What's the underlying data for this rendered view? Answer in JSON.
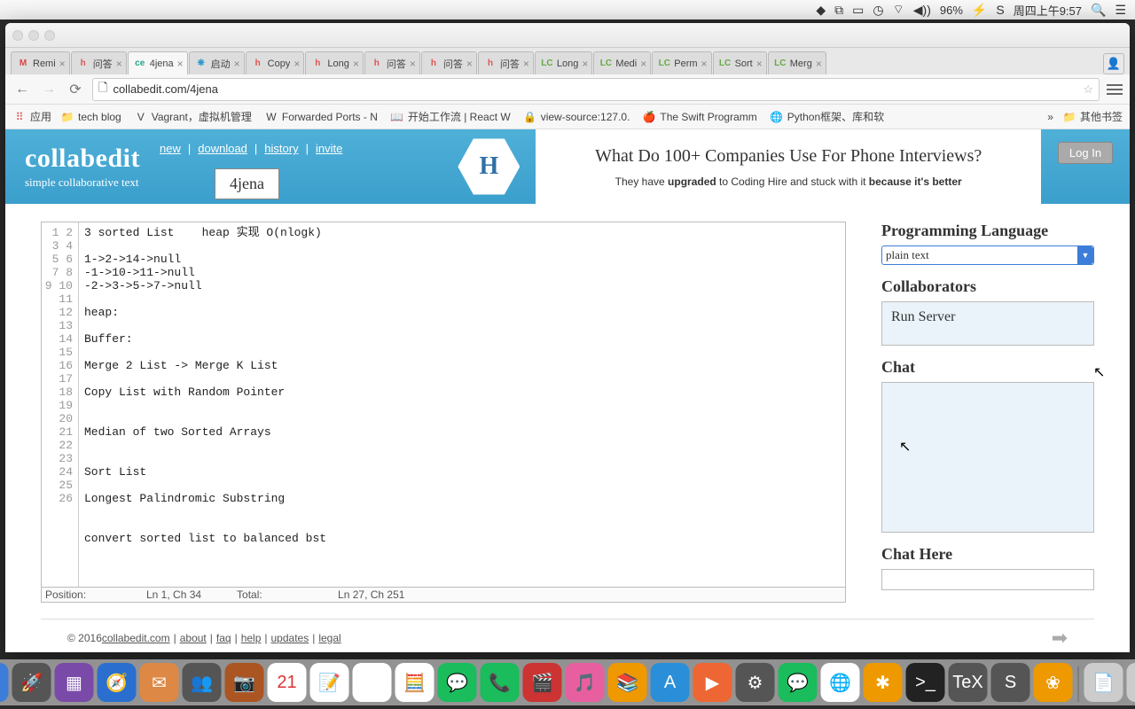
{
  "menubar": {
    "battery": "96%",
    "clock": "周四上午9:57"
  },
  "tabs": [
    {
      "fav": "M",
      "favcolor": "#d44",
      "title": "Remi"
    },
    {
      "fav": "h",
      "favcolor": "#d55",
      "title": "问答"
    },
    {
      "fav": "ce",
      "favcolor": "#2a8",
      "title": "4jena",
      "active": true
    },
    {
      "fav": "❋",
      "favcolor": "#39c",
      "title": "启动"
    },
    {
      "fav": "h",
      "favcolor": "#d55",
      "title": "Copy"
    },
    {
      "fav": "h",
      "favcolor": "#d55",
      "title": "Long"
    },
    {
      "fav": "h",
      "favcolor": "#d55",
      "title": "问答"
    },
    {
      "fav": "h",
      "favcolor": "#d55",
      "title": "问答"
    },
    {
      "fav": "h",
      "favcolor": "#d55",
      "title": "问答"
    },
    {
      "fav": "LC",
      "favcolor": "#6a4",
      "title": "Long"
    },
    {
      "fav": "LC",
      "favcolor": "#6a4",
      "title": "Medi"
    },
    {
      "fav": "LC",
      "favcolor": "#6a4",
      "title": "Perm"
    },
    {
      "fav": "LC",
      "favcolor": "#6a4",
      "title": "Sort"
    },
    {
      "fav": "LC",
      "favcolor": "#6a4",
      "title": "Merg"
    }
  ],
  "url": "collabedit.com/4jena",
  "bookmarks": {
    "apps": "应用",
    "items": [
      {
        "ic": "📁",
        "t": "tech blog"
      },
      {
        "ic": "V",
        "t": "Vagrant，虚拟机管理"
      },
      {
        "ic": "W",
        "t": "Forwarded Ports - N"
      },
      {
        "ic": "📖",
        "t": "开始工作流 | React W"
      },
      {
        "ic": "🔒",
        "t": "view-source:127.0."
      },
      {
        "ic": "🍎",
        "t": "The Swift Programm"
      },
      {
        "ic": "🌐",
        "t": "Python框架、库和软"
      }
    ],
    "more": "»",
    "other": "其他书签"
  },
  "brand": {
    "title": "collabedit",
    "sub": "simple collaborative text"
  },
  "nav": {
    "new": "new",
    "download": "download",
    "history": "history",
    "invite": "invite"
  },
  "docid": "4jena",
  "ad": {
    "headline": "What Do 100+ Companies Use For Phone Interviews?",
    "sub_pre": "They have ",
    "sub_b1": "upgraded",
    "sub_mid": " to Coding Hire and stuck with it ",
    "sub_b2": "because it's better"
  },
  "login": "Log In",
  "code": {
    "lines": [
      "3 sorted List    heap 实现 O(nlogk)",
      "",
      "1->2->14->null",
      "-1->10->11->null",
      "-2->3->5->7->null",
      "",
      "heap:",
      "",
      "Buffer:",
      "",
      "Merge 2 List -> Merge K List",
      "",
      "Copy List with Random Pointer",
      "",
      "",
      "Median of two Sorted Arrays",
      "",
      "",
      "Sort List",
      "",
      "Longest Palindromic Substring",
      "",
      "",
      "convert sorted list to balanced bst",
      "",
      ""
    ]
  },
  "status": {
    "plabel": "Position:",
    "pos": "Ln 1, Ch 34",
    "tlabel": "Total:",
    "tot": "Ln 27, Ch 251"
  },
  "side": {
    "lang_h": "Programming Language",
    "lang_v": "plain text",
    "collab_h": "Collaborators",
    "collab_v": "Run Server",
    "chat_h": "Chat",
    "chatin_h": "Chat Here"
  },
  "footer": {
    "copy": "© 2016 ",
    "site": "collabedit.com",
    "links": [
      "about",
      "faq",
      "help",
      "updates",
      "legal"
    ]
  },
  "dock": [
    {
      "c": "#3b7dd8",
      "i": "☺"
    },
    {
      "c": "#555",
      "i": "🚀"
    },
    {
      "c": "#7a4aa8",
      "i": "▦"
    },
    {
      "c": "#2a6fd0",
      "i": "🧭"
    },
    {
      "c": "#d84",
      "i": "✉"
    },
    {
      "c": "#555",
      "i": "👥"
    },
    {
      "c": "#a52",
      "i": "📷"
    },
    {
      "c": "#fff",
      "i": "21",
      "tc": "#d33"
    },
    {
      "c": "#fff",
      "i": "📝"
    },
    {
      "c": "#fff",
      "i": "🗒"
    },
    {
      "c": "#fff",
      "i": "🧮"
    },
    {
      "c": "#1abc5c",
      "i": "💬"
    },
    {
      "c": "#1abc5c",
      "i": "📞"
    },
    {
      "c": "#c33",
      "i": "🎬"
    },
    {
      "c": "#e85fa0",
      "i": "🎵"
    },
    {
      "c": "#e90",
      "i": "📚"
    },
    {
      "c": "#2a8fd8",
      "i": "A"
    },
    {
      "c": "#e63",
      "i": "▶"
    },
    {
      "c": "#555",
      "i": "⚙"
    },
    {
      "c": "#1abc5c",
      "i": "💬"
    },
    {
      "c": "#fff",
      "i": "🌐"
    },
    {
      "c": "#e90",
      "i": "✱"
    },
    {
      "c": "#222",
      "i": ">_"
    },
    {
      "c": "#555",
      "i": "TeX"
    },
    {
      "c": "#555",
      "i": "S"
    },
    {
      "c": "#e90",
      "i": "❀"
    }
  ],
  "dock_r": [
    {
      "c": "#ccc",
      "i": "📄"
    },
    {
      "c": "#ccc",
      "i": "🗑"
    }
  ]
}
